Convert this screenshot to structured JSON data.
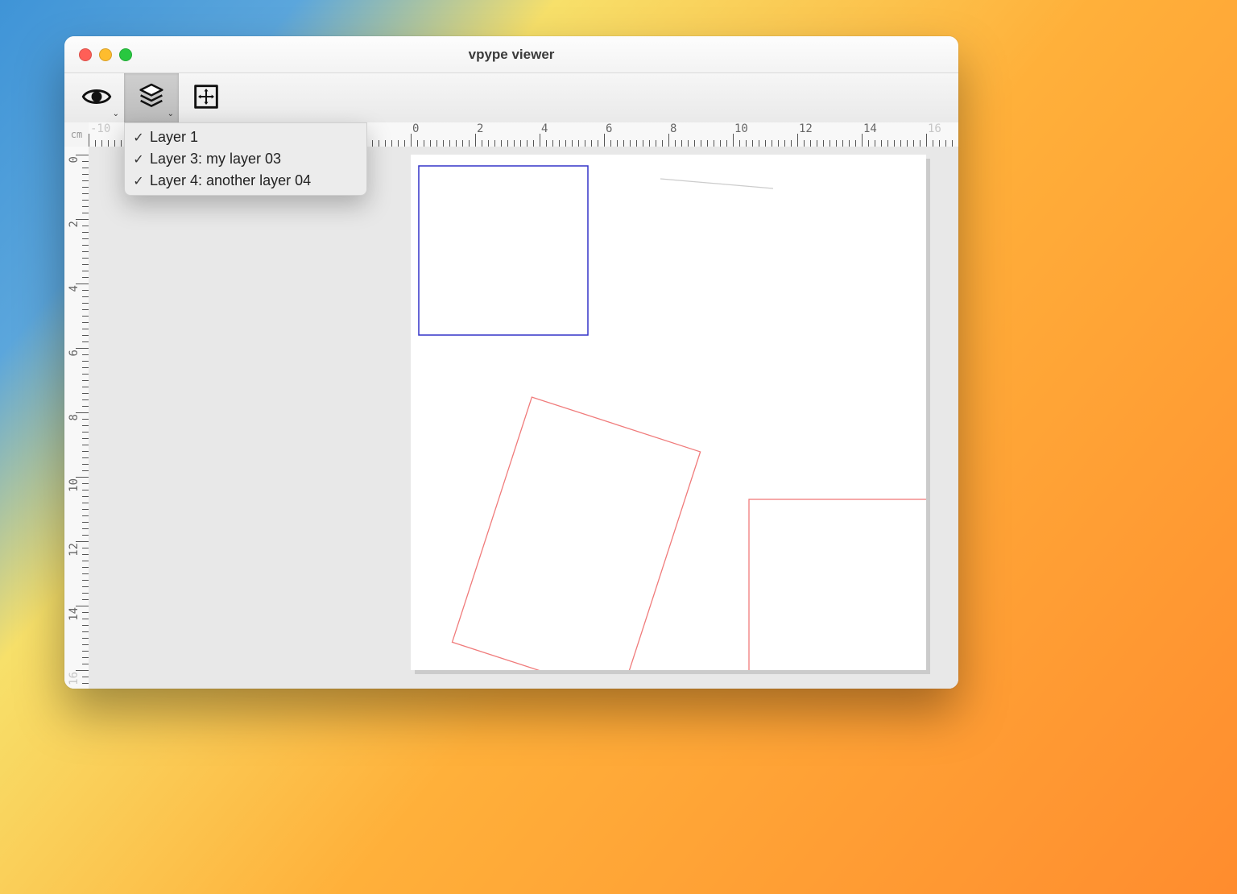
{
  "window": {
    "title": "vpype viewer"
  },
  "toolbar": {
    "buttons": [
      {
        "name": "view-mode-button",
        "icon": "eye-icon",
        "has_dropdown": true,
        "active": false
      },
      {
        "name": "layers-button",
        "icon": "layers-icon",
        "has_dropdown": true,
        "active": true
      },
      {
        "name": "fit-button",
        "icon": "fit-icon",
        "has_dropdown": false,
        "active": false
      }
    ]
  },
  "ruler": {
    "unit": "cm",
    "h_labels": [
      "-10",
      "0",
      "2",
      "4",
      "6",
      "8",
      "10",
      "12",
      "14",
      "16"
    ],
    "v_labels": [
      "0",
      "2",
      "4",
      "6",
      "8",
      "10",
      "12",
      "14",
      "16"
    ]
  },
  "layers_menu": {
    "items": [
      {
        "label": "Layer 1",
        "checked": true
      },
      {
        "label": "Layer 3: my layer 03",
        "checked": true
      },
      {
        "label": "Layer 4: another layer 04",
        "checked": true
      }
    ]
  },
  "canvas": {
    "shapes": [
      {
        "kind": "rect",
        "stroke": "#3434c8"
      },
      {
        "kind": "rotated-rect",
        "stroke": "#f07b7b"
      },
      {
        "kind": "rect",
        "stroke": "#f07b7b"
      },
      {
        "kind": "line",
        "stroke": "#cccccc"
      }
    ]
  }
}
